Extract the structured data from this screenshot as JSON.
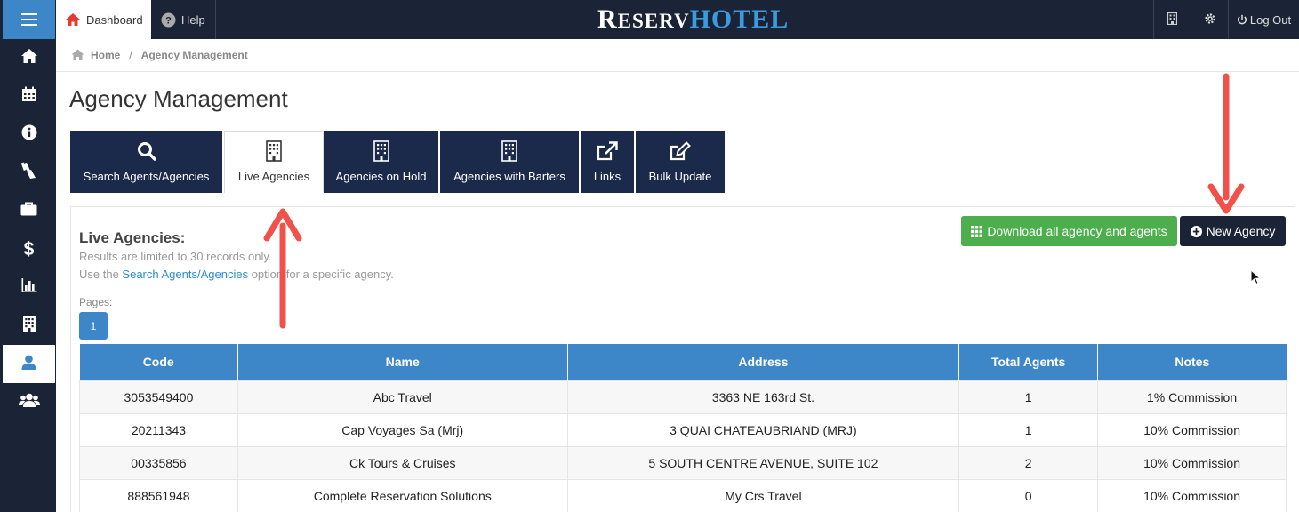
{
  "header": {
    "dashboard_label": "Dashboard",
    "help_label": "Help",
    "logo_part1": "R",
    "logo_part1_small": "ESERV",
    "logo_part2": "HOTEL",
    "logout_label": "Log Out"
  },
  "sidebar": {
    "items": [
      "home-icon",
      "calendar-icon",
      "info-icon",
      "housekeeping-icon",
      "briefcase-icon",
      "dollar-icon",
      "bar-chart-icon",
      "building-icon",
      "user-icon",
      "users-icon"
    ],
    "active_item": "user-icon"
  },
  "breadcrumb": {
    "home": "Home",
    "current": "Agency Management"
  },
  "page": {
    "title": "Agency Management"
  },
  "tabs": [
    {
      "label": "Search Agents/Agencies",
      "icon": "search-icon"
    },
    {
      "label": "Live Agencies",
      "icon": "building-icon"
    },
    {
      "label": "Agencies on Hold",
      "icon": "building-icon"
    },
    {
      "label": "Agencies with Barters",
      "icon": "building-icon"
    },
    {
      "label": "Links",
      "icon": "external-link-icon"
    },
    {
      "label": "Bulk Update",
      "icon": "edit-icon"
    }
  ],
  "active_tab": "Live Agencies",
  "panel": {
    "title": "Live Agencies:",
    "note1": "Results are limited to 30 records only.",
    "note2_prefix": "Use the ",
    "note2_link": "Search Agents/Agencies",
    "note2_suffix": " option for a specific agency.",
    "pages_label": "Pages:",
    "current_page": "1",
    "download_label": "Download all agency and agents",
    "new_agency_label": "New Agency"
  },
  "table": {
    "columns": [
      "Code",
      "Name",
      "Address",
      "Total Agents",
      "Notes"
    ],
    "rows": [
      [
        "3053549400",
        "Abc Travel",
        "3363 NE 163rd St.",
        "1",
        "1% Commission"
      ],
      [
        "20211343",
        "Cap Voyages Sa (Mrj)",
        "3 QUAI CHATEAUBRIAND (MRJ)",
        "1",
        "10% Commission"
      ],
      [
        "00335856",
        "Ck Tours & Cruises",
        "5 SOUTH CENTRE AVENUE, SUITE 102",
        "2",
        "10% Commission"
      ],
      [
        "888561948",
        "Complete Reservation Solutions",
        "My Crs Travel",
        "0",
        "10% Commission"
      ]
    ]
  },
  "colors": {
    "navy": "#1b2436",
    "accent_blue": "#3d87c8",
    "green": "#4cae4c",
    "arrow_red": "#f0524a"
  }
}
